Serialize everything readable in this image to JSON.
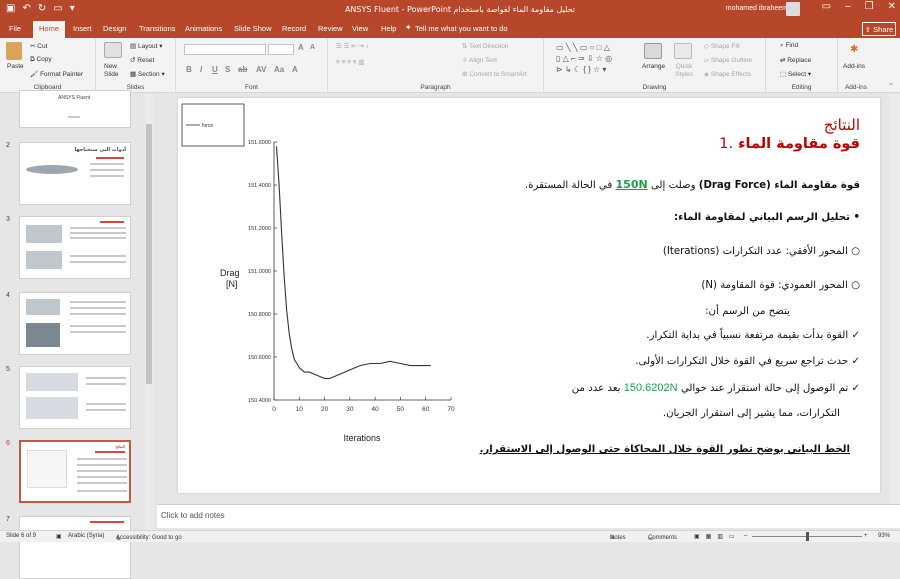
{
  "titlebar": {
    "title": "تحليل مقاومة الماء لغواصة باستخدام ANSYS Fluent  -  PowerPoint",
    "user": "mohamed ibraheem"
  },
  "tabs": [
    "File",
    "Home",
    "Insert",
    "Design",
    "Transitions",
    "Animations",
    "Slide Show",
    "Record",
    "Review",
    "View",
    "Help"
  ],
  "tell_me": "Tell me what you want to do",
  "share": "Share",
  "ribbon": {
    "clipboard": {
      "label": "Clipboard",
      "paste": "Paste",
      "cut": "Cut",
      "copy": "Copy",
      "format_painter": "Format Painter"
    },
    "slides": {
      "label": "Slides",
      "new_slide": "New Slide",
      "layout": "Layout",
      "reset": "Reset",
      "section": "Section"
    },
    "font": {
      "label": "Font"
    },
    "paragraph": {
      "label": "Paragraph",
      "text_direction": "Text Direction",
      "align_text": "Align Text",
      "smartart": "Convert to SmartArt"
    },
    "drawing": {
      "label": "Drawing",
      "arrange": "Arrange",
      "quick_styles": "Quick Styles",
      "shape_fill": "Shape Fill",
      "shape_outline": "Shape Outline",
      "shape_effects": "Shape Effects"
    },
    "editing": {
      "label": "Editing",
      "find": "Find",
      "replace": "Replace",
      "select": "Select"
    },
    "addins": {
      "label": "Add-ins",
      "addins": "Add-ins"
    }
  },
  "thumbnails": [
    {
      "num": "",
      "title": "ANSYS Fluent"
    },
    {
      "num": "2",
      "title": "أدوات التي سنحتاجها"
    },
    {
      "num": "3",
      "title": ""
    },
    {
      "num": "4",
      "title": ""
    },
    {
      "num": "5",
      "title": ""
    },
    {
      "num": "6",
      "title": "النتائج"
    },
    {
      "num": "7",
      "title": ""
    }
  ],
  "slide": {
    "heading1": "النتائج",
    "heading2": "قوة مقاومة الماء",
    "heading2_num": ".1",
    "p1_a": "قوة مقاومة الماء ",
    "p1_b": "(Drag Force)",
    "p1_c": " وصلت إلى ",
    "p1_value": "150N",
    "p1_d": " في الحالة المستقرة.",
    "bullet1": "تحليل الرسم البياني لمقاومة الماء:",
    "sub1": "المحور الأفقي: عدد التكرارات (Iterations)",
    "sub2": "المحور العمودي: قوة المقاومة (N)",
    "from_chart": "يتضح من الرسم أن:",
    "check1": "القوة بدأت بقيمة مرتفعة نسبياً في بداية التكرار.",
    "check2": "حدث تراجع سريع في القوة خلال التكرارات الأولى.",
    "check3_a": "تم الوصول إلى حالة استقرار عند حوالي ",
    "check3_value": "150.6202N",
    "check3_b": " بعد عدد من",
    "check3_c": "التكرارات، مما يشير إلى استقرار الجريان.",
    "caption": "الخط البياني يوضح تطور القوة خلال المحاكاة حتى الوصول إلى الاستقرار."
  },
  "chart_data": {
    "type": "line",
    "legend": [
      "force"
    ],
    "xlabel": "Iterations",
    "ylabel": "Drag [N]",
    "xlim": [
      0,
      70
    ],
    "ylim": [
      150.4,
      151.6
    ],
    "xticks": [
      "0",
      "10",
      "20",
      "30",
      "40",
      "50",
      "60",
      "70"
    ],
    "yticks": [
      "151.6000",
      "151.4000",
      "151.2000",
      "151.0000",
      "150.8000",
      "150.6000",
      "150.4000"
    ],
    "series": [
      {
        "x": [
          1,
          2,
          3,
          4,
          5,
          6,
          7,
          8,
          10,
          12,
          14,
          16,
          18,
          20,
          22,
          24,
          26,
          28,
          30,
          34,
          38,
          42,
          46,
          50,
          54,
          58,
          62
        ],
        "y": [
          151.58,
          151.4,
          151.18,
          150.98,
          150.82,
          150.71,
          150.64,
          150.59,
          150.55,
          150.53,
          150.53,
          150.52,
          150.51,
          150.5,
          150.5,
          150.51,
          150.52,
          150.53,
          150.54,
          150.56,
          150.57,
          150.57,
          150.58,
          150.57,
          150.56,
          150.56,
          150.56
        ]
      }
    ]
  },
  "notes_placeholder": "Click to add notes",
  "status": {
    "slide": "Slide 6 of 9",
    "lang": "Arabic (Syria)",
    "accessibility": "Accessibility: Good to go",
    "notes": "Notes",
    "comments": "Comments",
    "zoom": "93%"
  }
}
